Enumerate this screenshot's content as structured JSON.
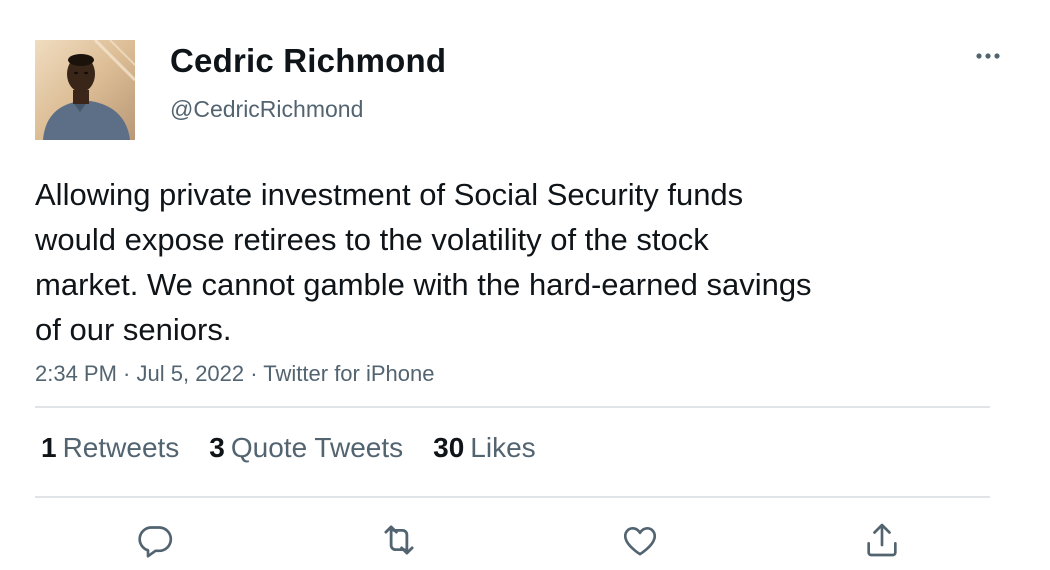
{
  "author": {
    "name": "Cedric Richmond",
    "handle": "@CedricRichmond"
  },
  "tweet": {
    "text": "Allowing private investment of Social Security funds\nwould expose retirees to the volatility of the stock\nmarket. We cannot gamble with the hard-earned savings\nof our seniors.",
    "time": "2:34 PM",
    "date": "Jul 5, 2022",
    "source": "Twitter for iPhone",
    "separator": " · "
  },
  "stats": {
    "retweets_count": "1",
    "retweets_label": "Retweets",
    "quotes_count": "3",
    "quotes_label": "Quote Tweets",
    "likes_count": "30",
    "likes_label": "Likes"
  },
  "icons": {
    "more": "more-horizontal-icon",
    "reply": "reply-icon",
    "retweet": "retweet-icon",
    "like": "heart-icon",
    "share": "share-icon"
  },
  "colors": {
    "text_primary": "#0f1419",
    "text_secondary": "#536471",
    "divider": "#e1e4e6"
  }
}
